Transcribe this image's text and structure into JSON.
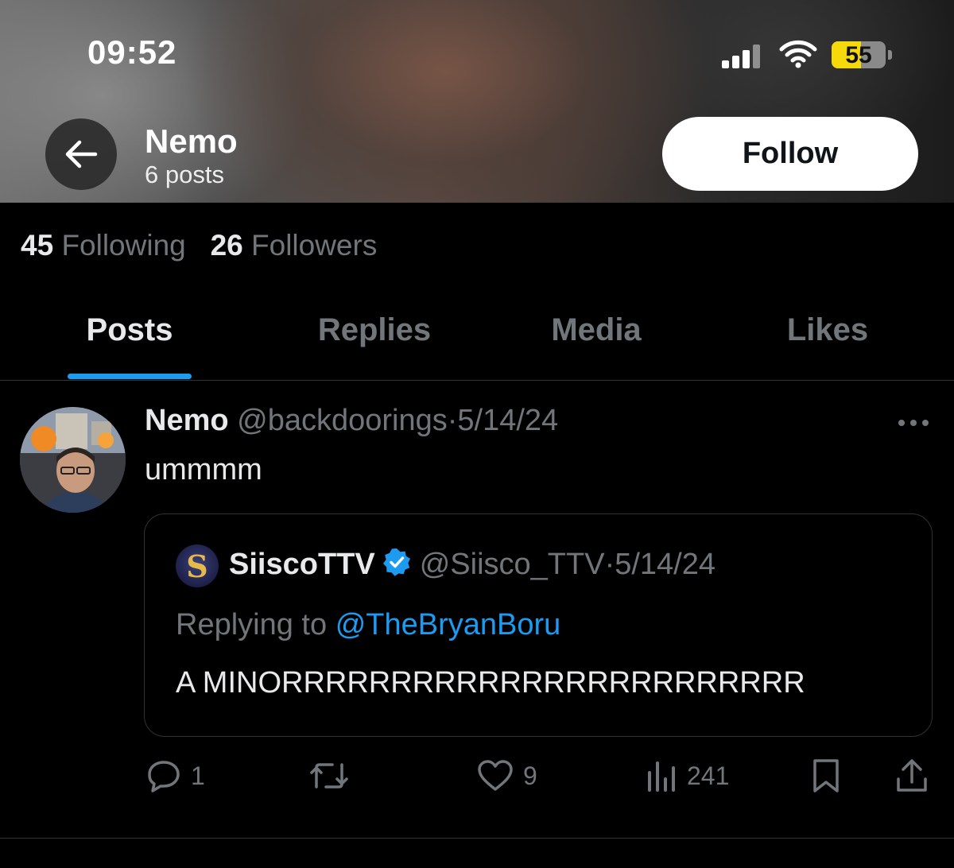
{
  "status_bar": {
    "time": "09:52",
    "battery": "55"
  },
  "header": {
    "name": "Nemo",
    "posts_count": "6 posts",
    "follow_label": "Follow"
  },
  "stats": {
    "following_count": "45",
    "following_label": "Following",
    "followers_count": "26",
    "followers_label": "Followers"
  },
  "tabs": [
    {
      "label": "Posts",
      "active": true
    },
    {
      "label": "Replies",
      "active": false
    },
    {
      "label": "Media",
      "active": false
    },
    {
      "label": "Likes",
      "active": false
    }
  ],
  "post": {
    "author_name": "Nemo",
    "author_handle": "@backdoorings",
    "separator": "·",
    "date": "5/14/24",
    "text": "ummmm",
    "quote": {
      "author_name": "SiiscoTTV",
      "author_handle": "@Siisco_TTV",
      "date": "5/14/24",
      "replying_to_label": "Replying to",
      "replying_to_handle": "@TheBryanBoru",
      "text": "A MINORRRRRRRRRRRRRRRRRRRRRRRR",
      "avatar_glyph": "S"
    },
    "actions": {
      "replies": "1",
      "likes": "9",
      "views": "241"
    }
  },
  "colors": {
    "background": "#000000",
    "accent": "#1d9bf0",
    "muted": "#71767b",
    "text": "#e7e9ea"
  },
  "icons": [
    "back-arrow-icon",
    "more-icon",
    "verified-badge-icon",
    "reply-icon",
    "repost-icon",
    "like-icon",
    "views-icon",
    "bookmark-icon",
    "share-icon",
    "wifi-icon",
    "signal-icon"
  ]
}
